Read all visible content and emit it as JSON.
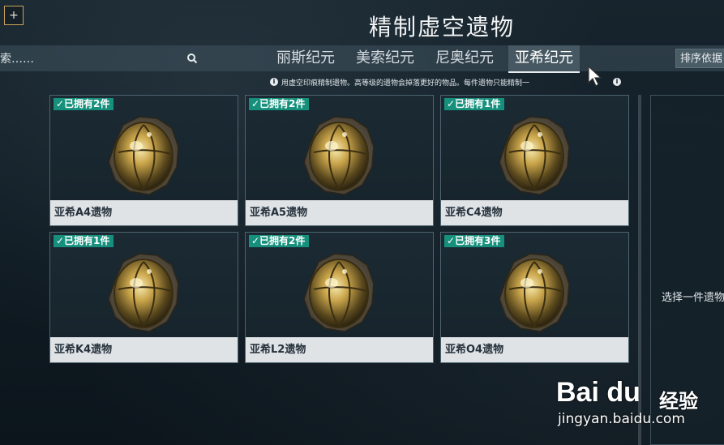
{
  "header": {
    "add_button_label": "+",
    "title": "精制虚空遗物"
  },
  "search": {
    "value": "索……",
    "icon": "search-icon"
  },
  "tabs": [
    {
      "label": "丽斯纪元",
      "active": false
    },
    {
      "label": "美索纪元",
      "active": false
    },
    {
      "label": "尼奥纪元",
      "active": false
    },
    {
      "label": "亚希纪元",
      "active": true
    }
  ],
  "sort_button": {
    "label": "排序依据"
  },
  "info": {
    "text": "用虚空印痕精制遗物。高等级的遗物会掉落更好的物品。每件遗物只能精制一",
    "icon": "info-icon"
  },
  "relics": [
    {
      "badge": "✓已拥有2件",
      "name": "亚希A4遗物",
      "owned": 2
    },
    {
      "badge": "✓已拥有2件",
      "name": "亚希A5遗物",
      "owned": 2
    },
    {
      "badge": "✓已拥有1件",
      "name": "亚希C4遗物",
      "owned": 1
    },
    {
      "badge": "✓已拥有1件",
      "name": "亚希K4遗物",
      "owned": 1
    },
    {
      "badge": "✓已拥有2件",
      "name": "亚希L2遗物",
      "owned": 2
    },
    {
      "badge": "✓已拥有3件",
      "name": "亚希O4遗物",
      "owned": 3
    }
  ],
  "right_panel": {
    "hint": "选择一件遗物"
  },
  "watermark": {
    "logo": "Bai du",
    "cn": "经验",
    "url": "jingyan.baidu.com"
  },
  "colors": {
    "badge": "#16907c",
    "label_bg": "#dfe3e6",
    "accent_gold": "#c9a45a"
  }
}
